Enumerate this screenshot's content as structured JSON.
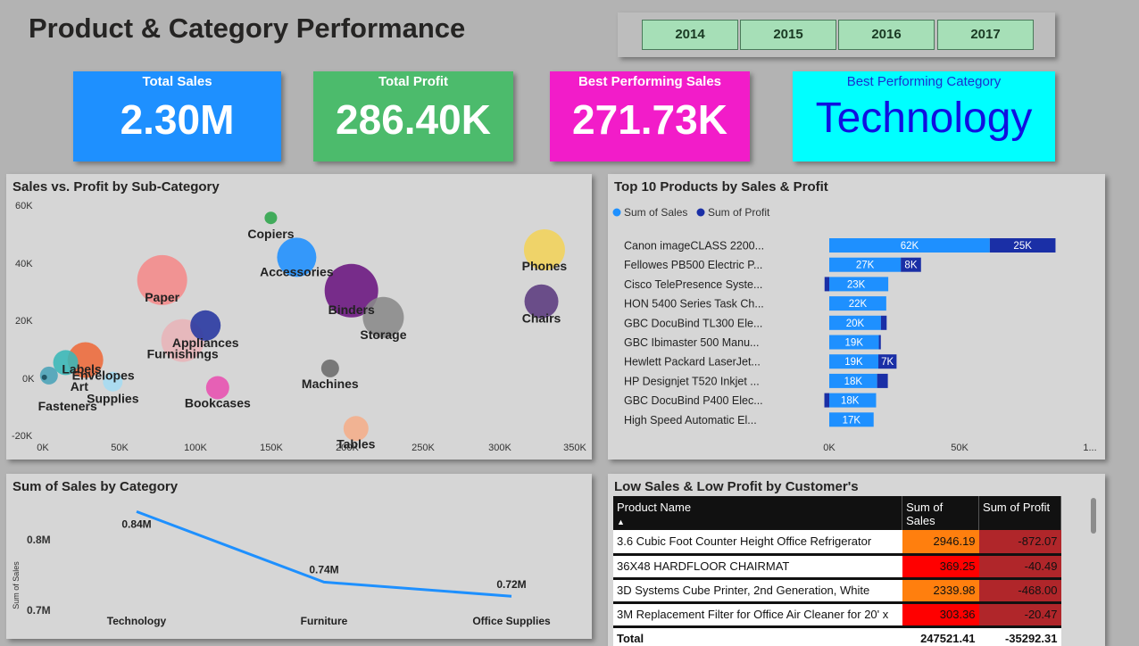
{
  "page_title": "Product & Category Performance",
  "years": [
    "2014",
    "2015",
    "2016",
    "2017"
  ],
  "cards": [
    {
      "label": "Total Sales",
      "value": "2.30M"
    },
    {
      "label": "Total Profit",
      "value": "286.40K"
    },
    {
      "label": "Best Performing Sales",
      "value": "271.73K"
    },
    {
      "label": "Best Performing Category",
      "value": "Technology"
    }
  ],
  "colors": {
    "sales_card": "#1e90ff",
    "profit_card": "#4cbb6c",
    "best_sales_card": "#f21cc9",
    "best_cat_card": "#00ffff",
    "sales_bar": "#1e90ff",
    "profit_bar": "#1a2fa6"
  },
  "scatter": {
    "title": "Sales vs. Profit by Sub-Category",
    "x_ticks": [
      "0K",
      "50K",
      "100K",
      "150K",
      "200K",
      "250K",
      "300K",
      "350K"
    ],
    "y_ticks": [
      "60K",
      "40K",
      "20K",
      "0K",
      "-20K"
    ]
  },
  "bar_panel": {
    "title": "Top 10 Products by Sales & Profit",
    "legend": [
      "Sum of Sales",
      "Sum of Profit"
    ],
    "x_ticks": [
      "0K",
      "50K",
      "1..."
    ]
  },
  "line_panel": {
    "title": "Sum of Sales by Category",
    "ylabel": "Sum of Sales",
    "y_ticks": [
      "0.8M",
      "0.7M"
    ]
  },
  "table": {
    "title": "Low Sales & Low Profit by Customer's",
    "columns": [
      "Product Name",
      "Sum of Sales",
      "Sum of Profit"
    ],
    "rows": [
      {
        "name": "3.6 Cubic Foot Counter Height Office Refrigerator",
        "sales": "2946.19",
        "profit": "-872.07"
      },
      {
        "name": "36X48 HARDFLOOR CHAIRMAT",
        "sales": "369.25",
        "profit": "-40.49"
      },
      {
        "name": "3D Systems Cube Printer, 2nd Generation, White",
        "sales": "2339.98",
        "profit": "-468.00"
      },
      {
        "name": "3M Replacement Filter for Office Air Cleaner for 20' x",
        "sales": "303.36",
        "profit": "-20.47"
      }
    ],
    "total": {
      "label": "Total",
      "sales": "247521.41",
      "profit": "-35292.31"
    }
  },
  "chart_data": [
    {
      "type": "scatter",
      "title": "Sales vs. Profit by Sub-Category",
      "xlim": [
        0,
        350000
      ],
      "ylim": [
        -20000,
        60000
      ],
      "points": [
        {
          "label": "Copiers",
          "x": 150000,
          "y": 55600,
          "size": 7,
          "color": "#2ca54a"
        },
        {
          "label": "Accessories",
          "x": 167000,
          "y": 41900,
          "size": 22,
          "color": "#1e90ff"
        },
        {
          "label": "Phones",
          "x": 330000,
          "y": 44500,
          "size": 23,
          "color": "#f2d35a"
        },
        {
          "label": "Paper",
          "x": 78500,
          "y": 34000,
          "size": 28,
          "color": "#f58a8a"
        },
        {
          "label": "Binders",
          "x": 203000,
          "y": 30300,
          "size": 30,
          "color": "#6a1480"
        },
        {
          "label": "Chairs",
          "x": 328000,
          "y": 26600,
          "size": 19,
          "color": "#5b3a7e"
        },
        {
          "label": "Storage",
          "x": 224000,
          "y": 21000,
          "size": 23,
          "color": "#8a8a8a"
        },
        {
          "label": "Appliances",
          "x": 107000,
          "y": 18200,
          "size": 17,
          "color": "#2536a0"
        },
        {
          "label": "Furnishings",
          "x": 92000,
          "y": 13000,
          "size": 24,
          "color": "#e8b4b8"
        },
        {
          "label": "Envelopes",
          "x": 28000,
          "y": 6200,
          "size": 20,
          "color": "#ee6a3a"
        },
        {
          "label": "Labels",
          "x": 15000,
          "y": 5300,
          "size": 14,
          "color": "#39b8b8"
        },
        {
          "label": "Machines",
          "x": 189000,
          "y": 3300,
          "size": 10,
          "color": "#6b6b6b"
        },
        {
          "label": "Supplies",
          "x": 46000,
          "y": -1300,
          "size": 11,
          "color": "#a5dcf2"
        },
        {
          "label": "Art",
          "x": 4000,
          "y": 800,
          "size": 10,
          "color": "#4aa3b8"
        },
        {
          "label": "Fasteners",
          "x": 1000,
          "y": 200,
          "size": 3,
          "color": "#1a4a5a"
        },
        {
          "label": "Bookcases",
          "x": 115000,
          "y": -3400,
          "size": 13,
          "color": "#e850b0"
        },
        {
          "label": "Tables",
          "x": 206000,
          "y": -17600,
          "size": 14,
          "color": "#f5ae8a"
        }
      ]
    },
    {
      "type": "bar",
      "title": "Top 10 Products by Sales & Profit",
      "xlim": [
        0,
        100000
      ],
      "categories": [
        "Canon imageCLASS 2200...",
        "Fellowes PB500 Electric P...",
        "Cisco TelePresence Syste...",
        "HON 5400 Series Task Ch...",
        "GBC DocuBind TL300 Ele...",
        "GBC Ibimaster 500 Manu...",
        "Hewlett Packard LaserJet...",
        "HP Designjet T520 Inkjet ...",
        "GBC DocuBind P400 Elec...",
        "High Speed Automatic El..."
      ],
      "series": [
        {
          "name": "Sum of Sales",
          "values": [
            61600,
            27450,
            22640,
            21870,
            19820,
            19020,
            18840,
            18370,
            17970,
            17030
          ],
          "labels": [
            "62K",
            "27K",
            "23K",
            "22K",
            "20K",
            "19K",
            "19K",
            "18K",
            "18K",
            "17K"
          ]
        },
        {
          "name": "Sum of Profit",
          "values": [
            25200,
            7750,
            -1800,
            0,
            2200,
            760,
            6980,
            4100,
            -1880,
            0
          ],
          "labels": [
            "25K",
            "8K",
            "",
            "",
            "",
            "",
            "7K",
            "",
            "",
            ""
          ]
        }
      ]
    },
    {
      "type": "line",
      "title": "Sum of Sales by Category",
      "ylabel": "Sum of Sales",
      "ylim": [
        0.7,
        0.8
      ],
      "categories": [
        "Technology",
        "Furniture",
        "Office Supplies"
      ],
      "values": [
        0.84,
        0.74,
        0.72
      ],
      "labels": [
        "0.84M",
        "0.74M",
        "0.72M"
      ]
    }
  ]
}
